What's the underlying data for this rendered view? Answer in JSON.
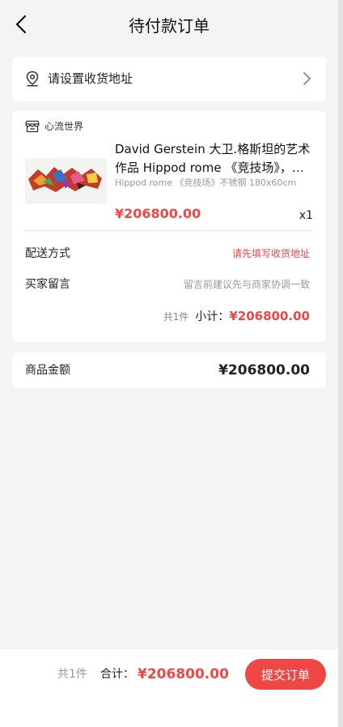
{
  "header": {
    "title": "待付款订单",
    "back_icon": "chevron-left-icon"
  },
  "address": {
    "prompt": "请设置收货地址",
    "pin_icon": "location-pin-icon",
    "arrow_icon": "chevron-right-icon"
  },
  "shop": {
    "name": "心流世界",
    "icon": "store-icon"
  },
  "product": {
    "title": "David Gerstein 大卫.格斯坦的艺术作品 Hippod rome 《竞技场》，不锈钢",
    "spec": "Hippod rome 《竞技场》不锈钢 180x60cm",
    "price": "¥206800.00",
    "quantity": "x1"
  },
  "delivery": {
    "label": "配送方式",
    "value": "请先填写收货地址"
  },
  "message": {
    "label": "买家留言",
    "placeholder": "留言前建议先与商家协调一致"
  },
  "subtotal": {
    "count": "共1件",
    "label": "小计：",
    "amount": "¥206800.00"
  },
  "goods_amount": {
    "label": "商品金额",
    "value": "¥206800.00"
  },
  "footer": {
    "count": "共1件",
    "total_label": "合计：",
    "total": "¥206800.00",
    "submit_label": "提交订单"
  },
  "colors": {
    "accent": "#ef4646",
    "background": "#f4f4f4",
    "card": "#ffffff"
  }
}
